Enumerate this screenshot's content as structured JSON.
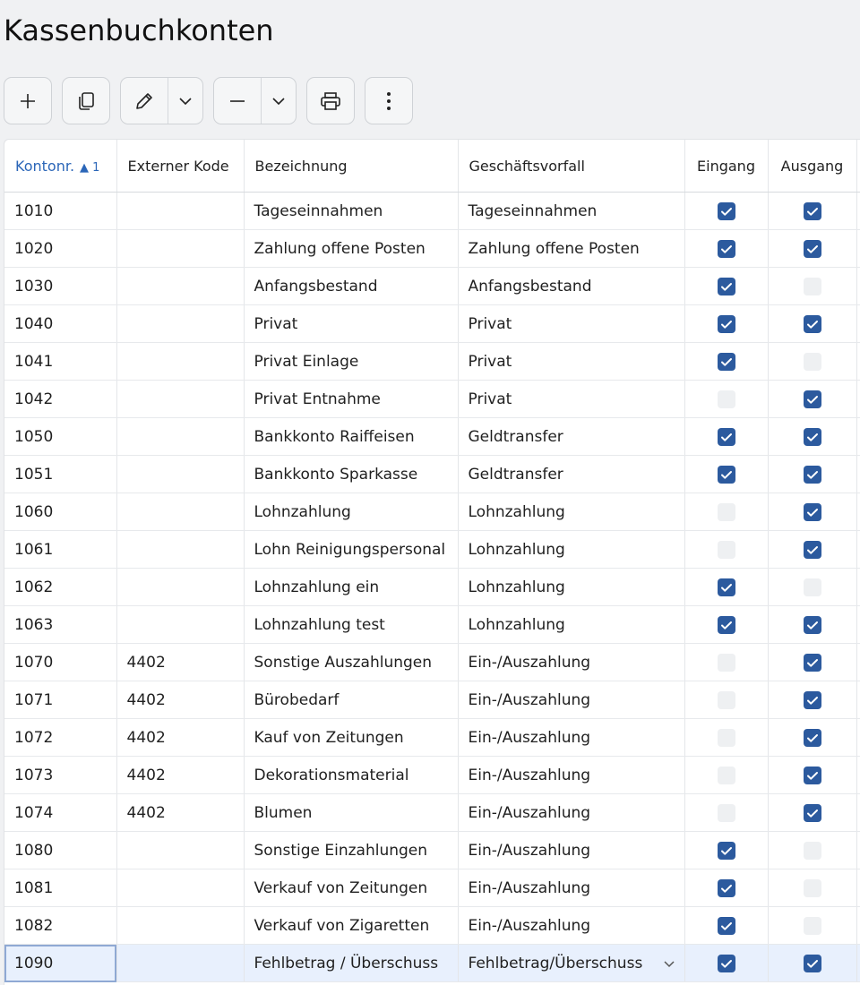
{
  "title": "Kassenbuchkonten",
  "toolbar": {
    "icons": [
      "plus-icon",
      "copy-icon",
      "pencil-icon",
      "chevron-down-icon",
      "minus-icon",
      "chevron-down-icon",
      "printer-icon",
      "more-vertical-icon"
    ]
  },
  "colors": {
    "accent": "#2c5a9e",
    "sorted_header": "#2b66b8",
    "selected_row": "#e8f0fd"
  },
  "columns": {
    "kontonr": "Kontonr.",
    "sort_order": "1",
    "extern": "Externer Kode",
    "bezeichnung": "Bezeichnung",
    "geschaeftsvorfall": "Geschäftsvorfall",
    "eingang": "Eingang",
    "ausgang": "Ausgang"
  },
  "rows": [
    {
      "kontonr": "1010",
      "extern": "",
      "bezeichnung": "Tageseinnahmen",
      "vorfall": "Tageseinnahmen",
      "eingang": true,
      "ausgang": true
    },
    {
      "kontonr": "1020",
      "extern": "",
      "bezeichnung": "Zahlung offene Posten",
      "vorfall": "Zahlung offene Posten",
      "eingang": true,
      "ausgang": true
    },
    {
      "kontonr": "1030",
      "extern": "",
      "bezeichnung": "Anfangsbestand",
      "vorfall": "Anfangsbestand",
      "eingang": true,
      "ausgang": false
    },
    {
      "kontonr": "1040",
      "extern": "",
      "bezeichnung": "Privat",
      "vorfall": "Privat",
      "eingang": true,
      "ausgang": true
    },
    {
      "kontonr": "1041",
      "extern": "",
      "bezeichnung": "Privat Einlage",
      "vorfall": "Privat",
      "eingang": true,
      "ausgang": false
    },
    {
      "kontonr": "1042",
      "extern": "",
      "bezeichnung": "Privat Entnahme",
      "vorfall": "Privat",
      "eingang": false,
      "ausgang": true
    },
    {
      "kontonr": "1050",
      "extern": "",
      "bezeichnung": "Bankkonto Raiffeisen",
      "vorfall": "Geldtransfer",
      "eingang": true,
      "ausgang": true
    },
    {
      "kontonr": "1051",
      "extern": "",
      "bezeichnung": "Bankkonto Sparkasse",
      "vorfall": "Geldtransfer",
      "eingang": true,
      "ausgang": true
    },
    {
      "kontonr": "1060",
      "extern": "",
      "bezeichnung": "Lohnzahlung",
      "vorfall": "Lohnzahlung",
      "eingang": false,
      "ausgang": true
    },
    {
      "kontonr": "1061",
      "extern": "",
      "bezeichnung": "Lohn Reinigungspersonal",
      "vorfall": "Lohnzahlung",
      "eingang": false,
      "ausgang": true
    },
    {
      "kontonr": "1062",
      "extern": "",
      "bezeichnung": "Lohnzahlung ein",
      "vorfall": "Lohnzahlung",
      "eingang": true,
      "ausgang": false
    },
    {
      "kontonr": "1063",
      "extern": "",
      "bezeichnung": "Lohnzahlung test",
      "vorfall": "Lohnzahlung",
      "eingang": true,
      "ausgang": true
    },
    {
      "kontonr": "1070",
      "extern": "4402",
      "bezeichnung": "Sonstige Auszahlungen",
      "vorfall": "Ein-/Auszahlung",
      "eingang": false,
      "ausgang": true
    },
    {
      "kontonr": "1071",
      "extern": "4402",
      "bezeichnung": "Bürobedarf",
      "vorfall": "Ein-/Auszahlung",
      "eingang": false,
      "ausgang": true
    },
    {
      "kontonr": "1072",
      "extern": "4402",
      "bezeichnung": "Kauf von Zeitungen",
      "vorfall": "Ein-/Auszahlung",
      "eingang": false,
      "ausgang": true
    },
    {
      "kontonr": "1073",
      "extern": "4402",
      "bezeichnung": "Dekorationsmaterial",
      "vorfall": "Ein-/Auszahlung",
      "eingang": false,
      "ausgang": true
    },
    {
      "kontonr": "1074",
      "extern": "4402",
      "bezeichnung": "Blumen",
      "vorfall": "Ein-/Auszahlung",
      "eingang": false,
      "ausgang": true
    },
    {
      "kontonr": "1080",
      "extern": "",
      "bezeichnung": "Sonstige Einzahlungen",
      "vorfall": "Ein-/Auszahlung",
      "eingang": true,
      "ausgang": false
    },
    {
      "kontonr": "1081",
      "extern": "",
      "bezeichnung": "Verkauf von Zeitungen",
      "vorfall": "Ein-/Auszahlung",
      "eingang": true,
      "ausgang": false
    },
    {
      "kontonr": "1082",
      "extern": "",
      "bezeichnung": "Verkauf von Zigaretten",
      "vorfall": "Ein-/Auszahlung",
      "eingang": true,
      "ausgang": false
    },
    {
      "kontonr": "1090",
      "extern": "",
      "bezeichnung": "Fehlbetrag / Überschuss",
      "vorfall": "Fehlbetrag/Überschuss",
      "eingang": true,
      "ausgang": true,
      "selected": true
    }
  ]
}
